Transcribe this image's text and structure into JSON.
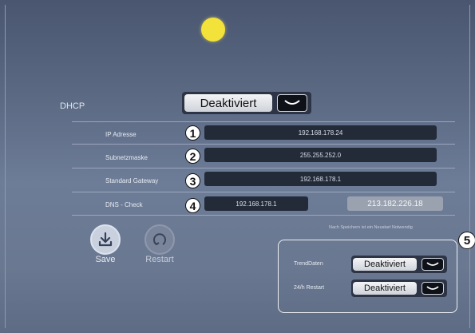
{
  "status": {
    "indicator_color": "#f2e23a"
  },
  "dhcp": {
    "label": "DHCP",
    "value": "Deaktiviert"
  },
  "network": {
    "rows": [
      {
        "badge": "1",
        "label": "IP Adresse",
        "value": "192.168.178.24"
      },
      {
        "badge": "2",
        "label": "Subnetzmaske",
        "value": "255.255.252.0"
      },
      {
        "badge": "3",
        "label": "Standard Gateway",
        "value": "192.168.178.1"
      }
    ],
    "dns": {
      "badge": "4",
      "label": "DNS - Check",
      "value": "192.168.178.1",
      "result": "213.182.226.18"
    }
  },
  "restart_note": "Nach Speichern ist ein Neustart Notwendig",
  "actions": {
    "save_label": "Save",
    "restart_label": "Restart"
  },
  "options": {
    "badge": "5",
    "trend": {
      "label": "TrendDaten",
      "value": "Deaktiviert"
    },
    "restart24": {
      "label": "24/h Restart",
      "value": "Deaktiviert"
    }
  }
}
